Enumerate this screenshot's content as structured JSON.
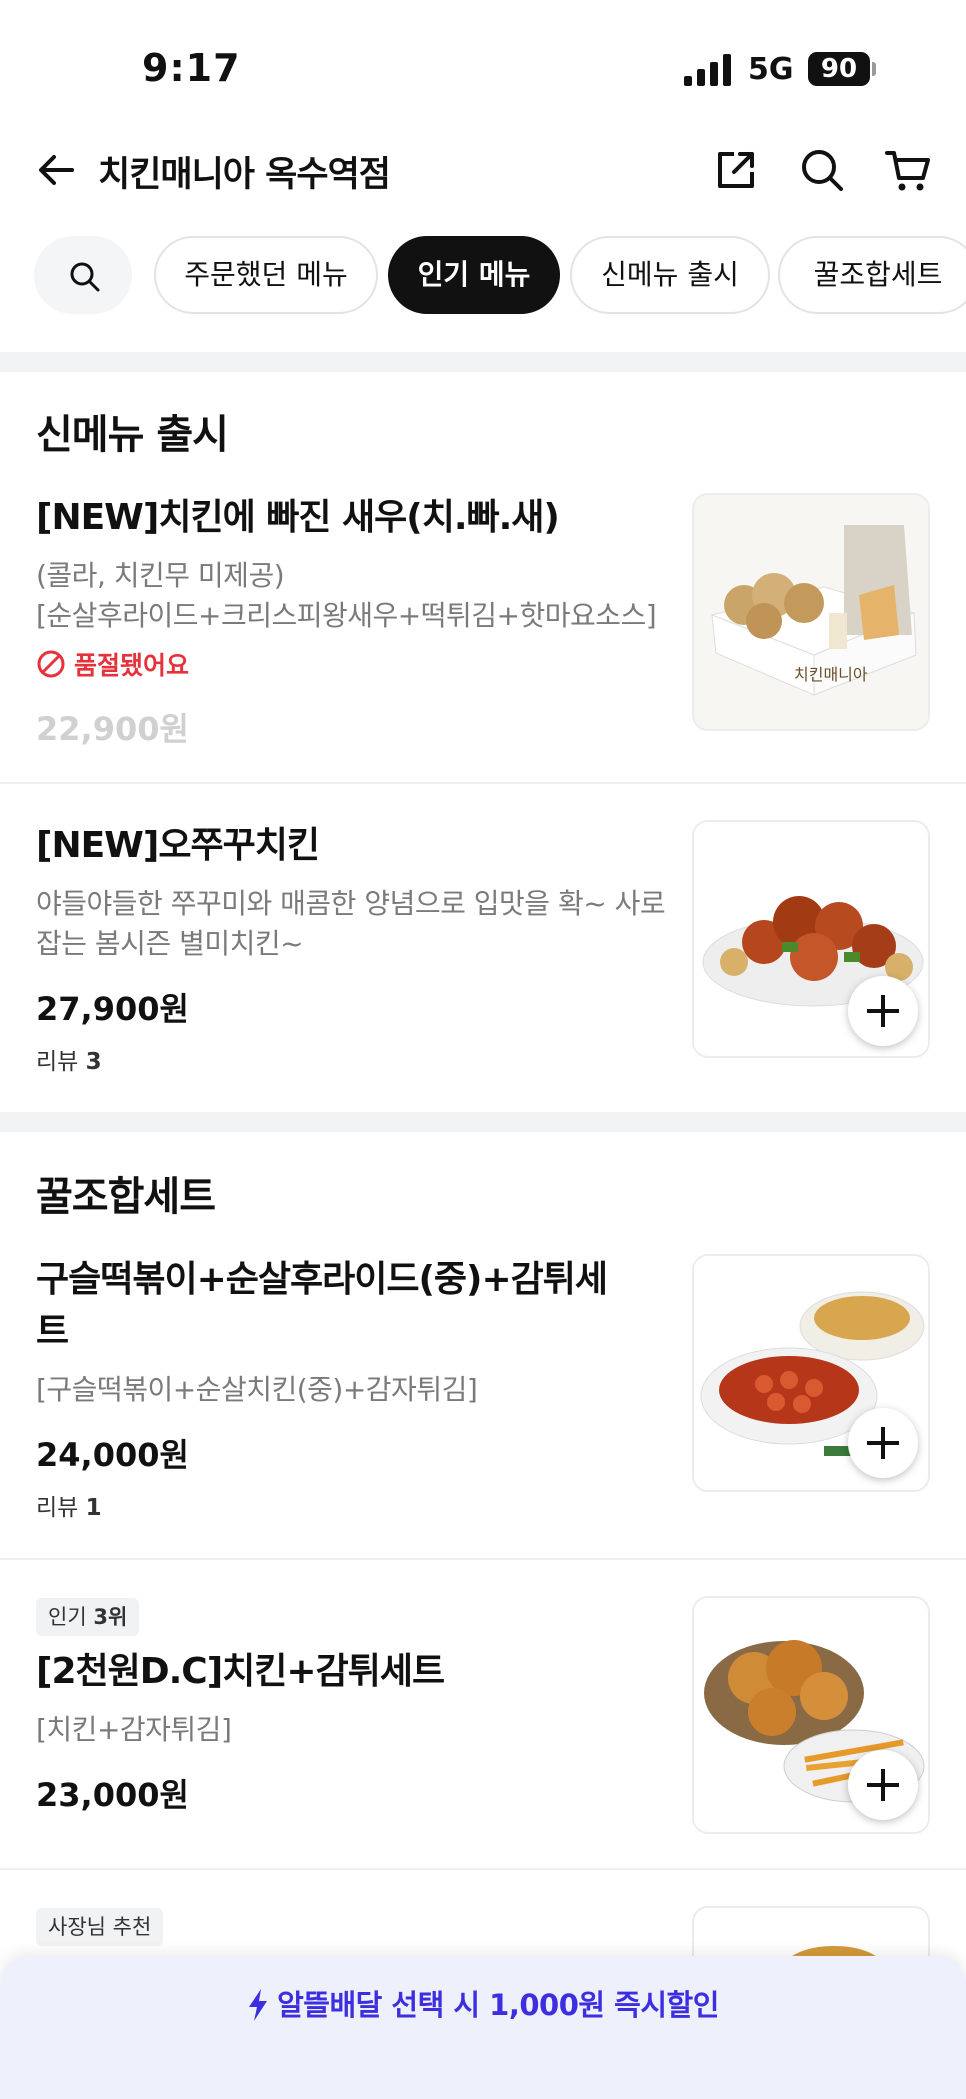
{
  "status": {
    "time": "9:17",
    "network": "5G",
    "battery": "90"
  },
  "header": {
    "title": "치킨매니아 옥수역점"
  },
  "chips": [
    "주문했던 메뉴",
    "인기 메뉴",
    "신메뉴 출시",
    "꿀조합세트"
  ],
  "active_chip": "인기 메뉴",
  "sections": [
    {
      "title": "신메뉴 출시",
      "items": [
        {
          "name": "[NEW]치킨에 빠진 새우(치.빠.새)",
          "desc1": "(콜라, 치킨무 미제공)",
          "desc2": "[순살후라이드+크리스피왕새우+떡튀김+핫마요소스]",
          "soldout": "품절됐어요",
          "price": "22,900원"
        },
        {
          "name": "[NEW]오쭈꾸치킨",
          "desc1": "야들야들한 쭈꾸미와 매콤한 양념으로 입맛을 확~ 사로",
          "desc2": "잡는 봄시즌 별미치킨~",
          "price": "27,900원",
          "review_label": "리뷰",
          "review_count": "3"
        }
      ]
    },
    {
      "title": "꿀조합세트",
      "items": [
        {
          "name1": "구슬떡볶이+순살후라이드(중)+감튀세",
          "name2": "트",
          "desc1": "[구슬떡볶이+순살치킨(중)+감자튀김]",
          "price": "24,000원",
          "review_label": "리뷰",
          "review_count": "1"
        },
        {
          "badge_prefix": "인기",
          "badge_rank": "3위",
          "name": "[2천원D.C]치킨+감튀세트",
          "desc1": "[치킨+감자튀김]",
          "price": "23,000원"
        },
        {
          "badge": "사장님 추천"
        }
      ]
    }
  ],
  "banner": {
    "prefix": "알뜰배달 선택 시 ",
    "amount": "1,000",
    "suffix": "원 즉시할인"
  },
  "colors": {
    "accent": "#3d2ee0",
    "soldout": "#e5323b",
    "chip_active": "#111111"
  },
  "icons": [
    "back-arrow-icon",
    "share-icon",
    "search-icon",
    "cart-icon",
    "lightning-icon",
    "prohibited-icon",
    "plus-icon"
  ]
}
